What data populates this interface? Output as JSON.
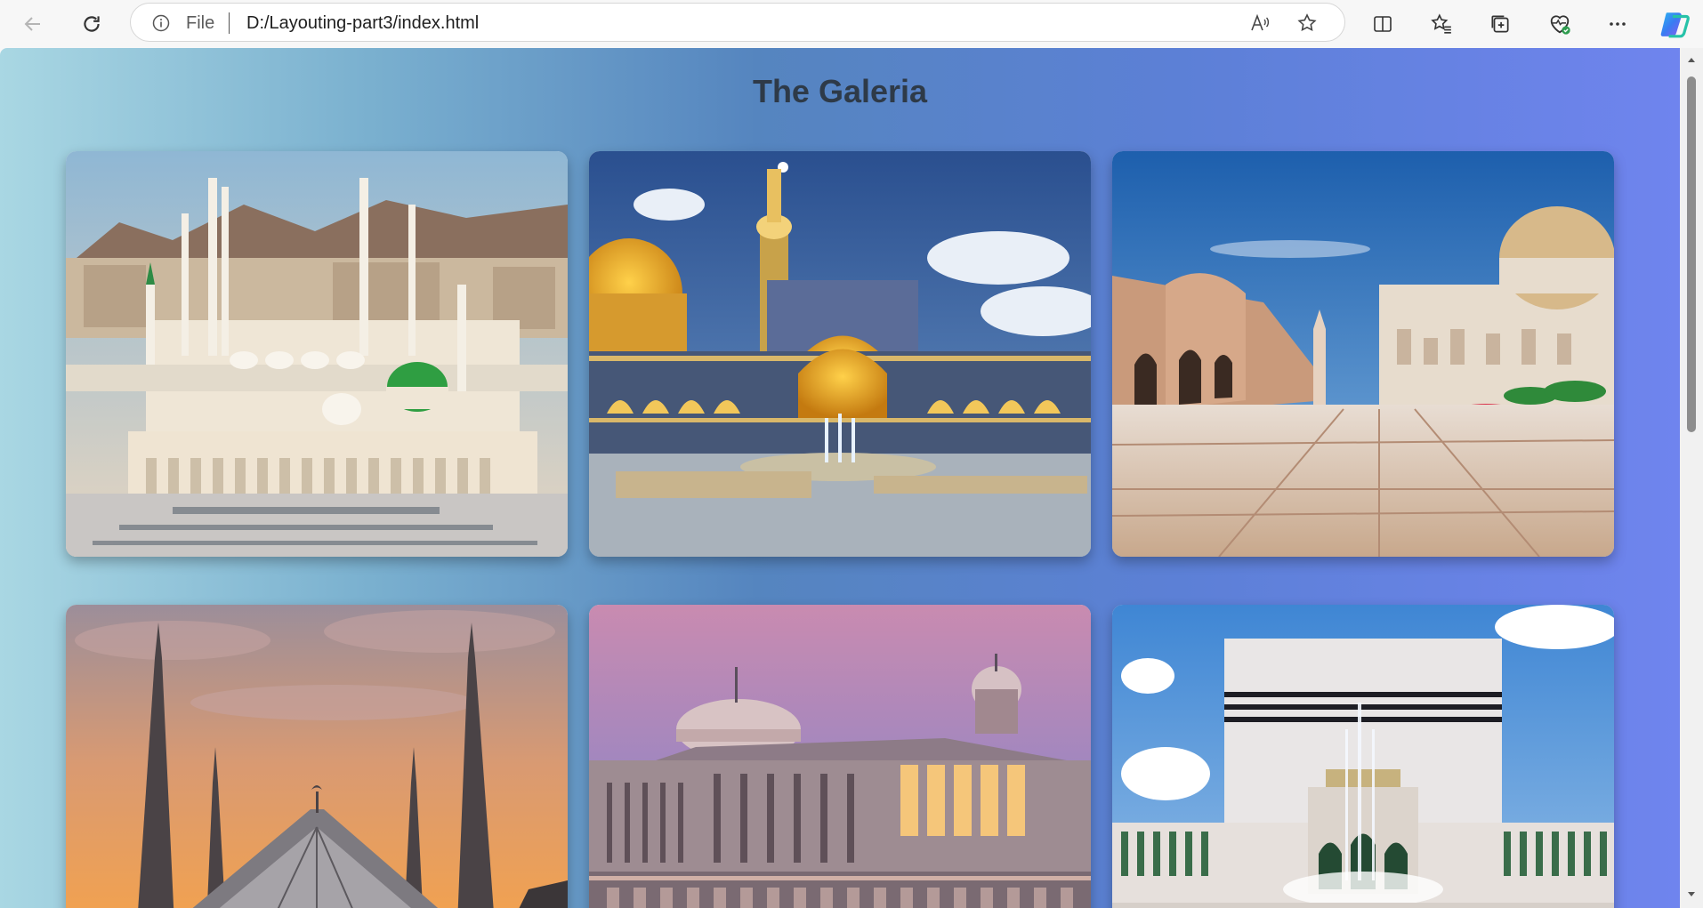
{
  "browser": {
    "info_label": "File",
    "url": "D:/Layouting-part3/index.html"
  },
  "page": {
    "title": "The Galeria"
  },
  "gallery": [
    {
      "name": "masjid-an-nabawi-photo"
    },
    {
      "name": "imam-reza-shrine-photo"
    },
    {
      "name": "sultan-qaboos-mosque-photo"
    },
    {
      "name": "faisal-mosque-photo"
    },
    {
      "name": "istiqlal-mosque-photo"
    },
    {
      "name": "baitul-mukarram-mosque-photo"
    }
  ],
  "colors": {
    "gradient_start": "#a9d7e3",
    "gradient_end": "#6f84ee",
    "title_color": "#2e3a48"
  }
}
